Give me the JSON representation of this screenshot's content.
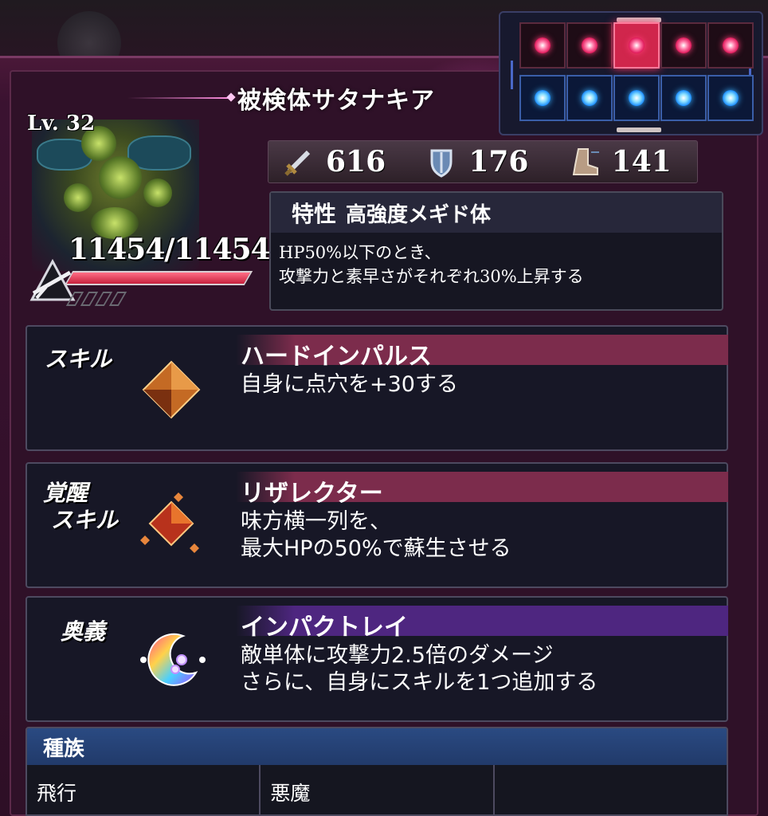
{
  "unit": {
    "name": "被検体サタナキア",
    "level": "Lv. 32",
    "hp": "11454/11454",
    "hp_fraction": 1.0
  },
  "stats": [
    {
      "icon": "sword-icon",
      "value": "616"
    },
    {
      "icon": "shield-icon",
      "value": "176"
    },
    {
      "icon": "boot-icon",
      "value": "141"
    }
  ],
  "trait": {
    "tag": "特性",
    "name": "高強度メギド体",
    "description_line1": "HP50%以下のとき、",
    "description_line2": "攻撃力と素早さがそれぞれ30%上昇する"
  },
  "skill": {
    "label": "スキル",
    "name": "ハードインパルス",
    "description_line1": "自身に点穴を+30する",
    "icon": "orange-crystal-icon"
  },
  "awaken_skill": {
    "label_line1": "覚醒",
    "label_line2": "スキル",
    "name": "リザレクター",
    "description_line1": "味方横一列を、",
    "description_line2": "最大HPの50%で蘇生させる",
    "icon": "crystal-cluster-icon"
  },
  "ougi": {
    "label": "奥義",
    "name": "インパクトレイ",
    "description_line1": "敵単体に攻撃力2.5倍のダメージ",
    "description_line2": "さらに、自身にスキルを1つ追加する",
    "icon": "rainbow-crescent-icon"
  },
  "race": {
    "header": "種族",
    "values": [
      "飛行",
      "悪魔",
      ""
    ]
  },
  "formation": {
    "front_active_index": 2,
    "colors": {
      "front": "#e0185a",
      "back": "#1a8cff"
    }
  }
}
